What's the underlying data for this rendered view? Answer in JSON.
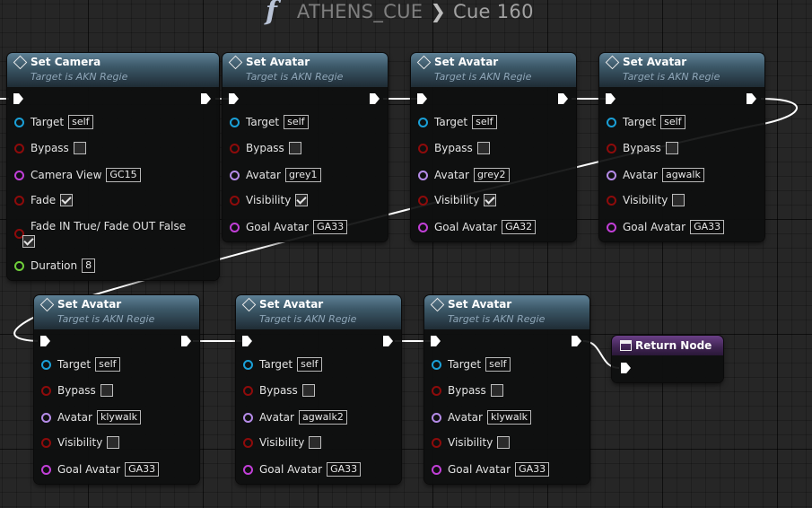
{
  "breadcrumb": {
    "icon": "function-icon",
    "parent": "ATHENS_CUE",
    "separator": "❯",
    "current": "Cue 160"
  },
  "nodes": {
    "n1": {
      "title": "Set Camera",
      "subtitle": "Target is AKN Regie",
      "target_label": "Target",
      "target_value": "self",
      "bypass_label": "Bypass",
      "bypass_checked": false,
      "camera_view_label": "Camera View",
      "camera_view_value": "GC15",
      "fade_label": "Fade",
      "fade_checked": true,
      "fade_in_out_label": "Fade IN True/ Fade OUT False",
      "fade_in_out_checked": true,
      "duration_label": "Duration",
      "duration_value": "8"
    },
    "n2": {
      "title": "Set Avatar",
      "subtitle": "Target is AKN Regie",
      "target_label": "Target",
      "target_value": "self",
      "bypass_label": "Bypass",
      "bypass_checked": false,
      "avatar_label": "Avatar",
      "avatar_value": "grey1",
      "visibility_label": "Visibility",
      "visibility_checked": true,
      "goal_label": "Goal Avatar",
      "goal_value": "GA33"
    },
    "n3": {
      "title": "Set Avatar",
      "subtitle": "Target is AKN Regie",
      "target_label": "Target",
      "target_value": "self",
      "bypass_label": "Bypass",
      "bypass_checked": false,
      "avatar_label": "Avatar",
      "avatar_value": "grey2",
      "visibility_label": "Visibility",
      "visibility_checked": true,
      "goal_label": "Goal Avatar",
      "goal_value": "GA32"
    },
    "n4": {
      "title": "Set Avatar",
      "subtitle": "Target is AKN Regie",
      "target_label": "Target",
      "target_value": "self",
      "bypass_label": "Bypass",
      "bypass_checked": false,
      "avatar_label": "Avatar",
      "avatar_value": "agwalk",
      "visibility_label": "Visibility",
      "visibility_checked": false,
      "goal_label": "Goal Avatar",
      "goal_value": "GA33"
    },
    "n5": {
      "title": "Set Avatar",
      "subtitle": "Target is AKN Regie",
      "target_label": "Target",
      "target_value": "self",
      "bypass_label": "Bypass",
      "bypass_checked": false,
      "avatar_label": "Avatar",
      "avatar_value": "klywalk",
      "visibility_label": "Visibility",
      "visibility_checked": false,
      "goal_label": "Goal Avatar",
      "goal_value": "GA33"
    },
    "n6": {
      "title": "Set Avatar",
      "subtitle": "Target is AKN Regie",
      "target_label": "Target",
      "target_value": "self",
      "bypass_label": "Bypass",
      "bypass_checked": false,
      "avatar_label": "Avatar",
      "avatar_value": "agwalk2",
      "visibility_label": "Visibility",
      "visibility_checked": false,
      "goal_label": "Goal Avatar",
      "goal_value": "GA33"
    },
    "n7": {
      "title": "Set Avatar",
      "subtitle": "Target is AKN Regie",
      "target_label": "Target",
      "target_value": "self",
      "bypass_label": "Bypass",
      "bypass_checked": false,
      "avatar_label": "Avatar",
      "avatar_value": "klywalk",
      "visibility_label": "Visibility",
      "visibility_checked": false,
      "goal_label": "Goal Avatar",
      "goal_value": "GA33"
    },
    "ret": {
      "title": "Return Node"
    }
  },
  "colors": {
    "pin_object": "#1aa0d8",
    "pin_bool": "#8e0b0b",
    "pin_string": "#c23fd8",
    "pin_name": "#b58be8",
    "pin_int": "#6fcf3a",
    "exec_wire": "#ffffff",
    "function_header": "#3c5868",
    "return_header": "#6a3f87"
  }
}
